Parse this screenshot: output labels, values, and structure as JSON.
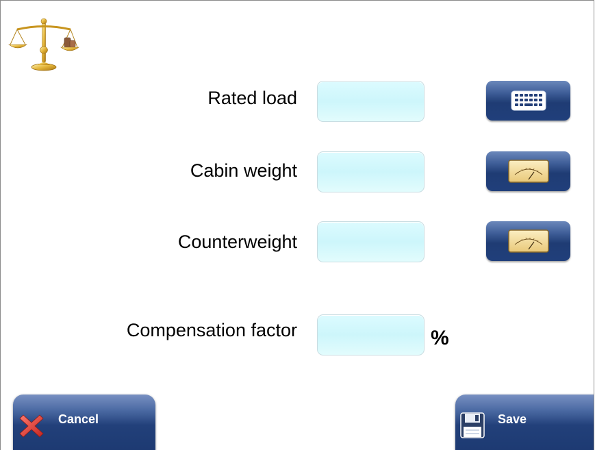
{
  "form": {
    "fields": [
      {
        "label": "Rated load",
        "value": "",
        "button_icon": "keyboard-icon"
      },
      {
        "label": "Cabin weight",
        "value": "",
        "button_icon": "weighing-gauge-icon"
      },
      {
        "label": "Counterweight",
        "value": "",
        "button_icon": "weighing-gauge-icon"
      },
      {
        "label": "Compensation factor",
        "value": "",
        "unit": "%"
      }
    ]
  },
  "footer": {
    "cancel_label": "Cancel",
    "save_label": "Save"
  },
  "icons": {
    "header": "scales-icon",
    "cancel": "close-icon",
    "save": "save-disk-icon"
  },
  "colors": {
    "field_fill": "#d4f8fc",
    "button_blue": "#23407a",
    "cancel_red": "#d83a35"
  }
}
